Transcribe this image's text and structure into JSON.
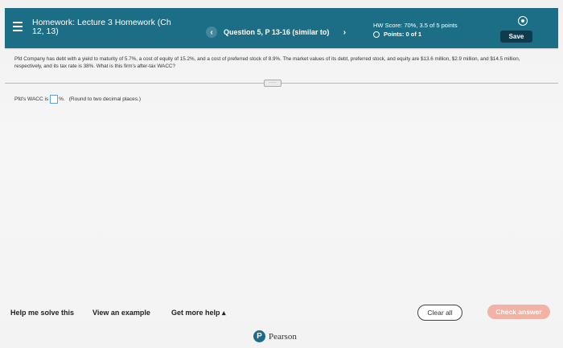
{
  "header": {
    "title_bold": "Homework: Lecture 3 Homework (Ch",
    "title_line2": "12, 13)",
    "question_label": "Question 5, P 13-16 (similar to)",
    "prev_glyph": "‹",
    "next_glyph": "›",
    "hw_score": "HW Score: 70%, 3.5 of 5 points",
    "points": "Points: 0 of 1",
    "save_label": "Save"
  },
  "question": {
    "text": "Pfd Company has debt with a yield to maturity of 5.7%, a cost of equity of 15.2%, and a cost of preferred stock of 8.9%. The market values of its debt, preferred stock, and equity are $13.6 million, $2.9 million, and $14.5 million, respectively, and its tax rate is 38%. What is this firm's after-tax WACC?",
    "expander_glyph": "·····"
  },
  "answer": {
    "prompt": "Pfd's WACC is",
    "unit": "%.",
    "hint": "(Round to two decimal places.)"
  },
  "footer": {
    "help_solve": "Help me solve this",
    "view_example": "View an example",
    "get_more_help": "Get more help ▴",
    "clear_all": "Clear all",
    "check_answer": "Check answer"
  },
  "brand": {
    "logo_letter": "P",
    "name": "Pearson"
  },
  "colors": {
    "header_bg": "#1c6e86",
    "save_bg": "#0e3c4e",
    "check_bg": "#f2b3a6",
    "input_border": "#5da0d2"
  },
  "icons": {
    "menu": "hamburger-menu-icon",
    "settings": "gear-icon",
    "points_status": "circle-icon"
  }
}
